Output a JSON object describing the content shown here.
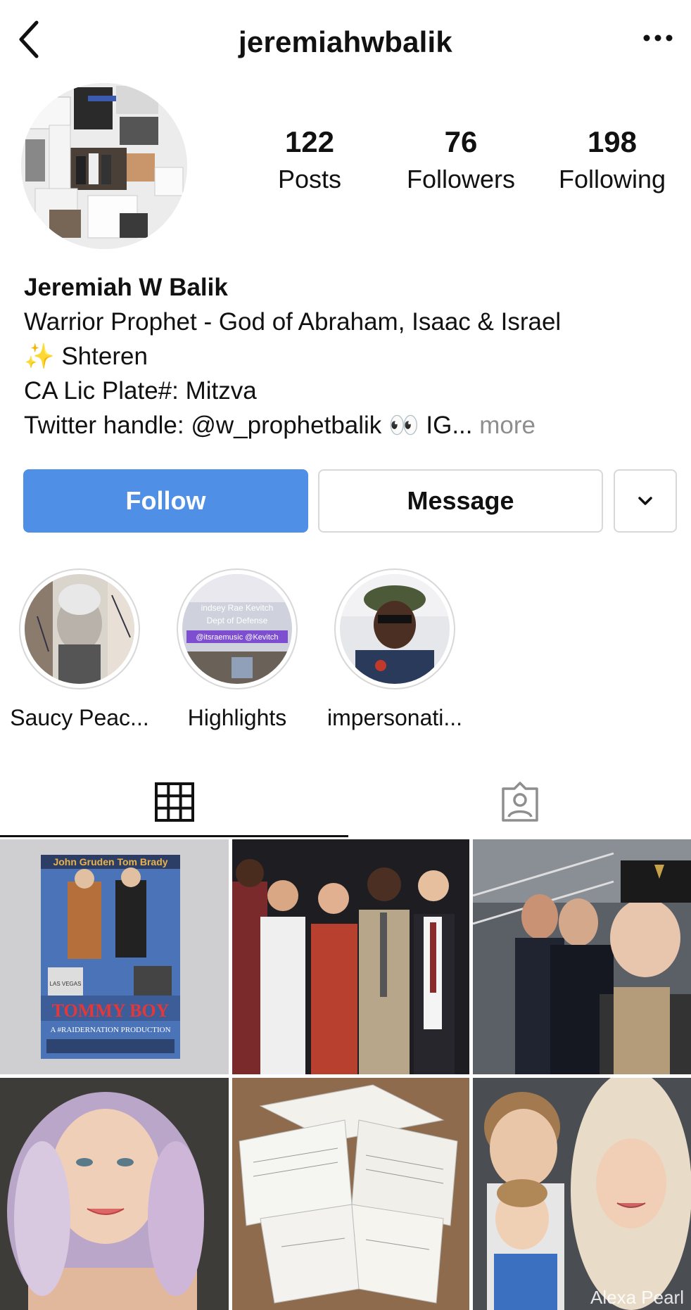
{
  "header": {
    "username": "jeremiahwbalik",
    "back_icon": "chevron-left-icon",
    "more_icon": "more-horizontal-icon"
  },
  "stats": {
    "posts": {
      "value": "122",
      "label": "Posts"
    },
    "followers": {
      "value": "76",
      "label": "Followers"
    },
    "following": {
      "value": "198",
      "label": "Following"
    }
  },
  "bio": {
    "name": "Jeremiah W Balik",
    "line1": "Warrior Prophet - God of Abraham, Isaac & Israel",
    "line2_emoji": "✨",
    "line2": "Shteren",
    "line3": "CA Lic Plate#: Mitzva",
    "line4": "Twitter handle: @w_prophetbalik",
    "line4_emoji": "👀",
    "line4_tail": " IG...",
    "more": " more"
  },
  "actions": {
    "follow": "Follow",
    "message": "Message",
    "dropdown_icon": "chevron-down-icon"
  },
  "highlights": [
    {
      "label": "Saucy Peac..."
    },
    {
      "label": "Highlights",
      "overlay_text": [
        "indsey Rae Kevitch",
        "Dept of Defense",
        "@itsraemusic @Kevitch"
      ]
    },
    {
      "label": "impersonati..."
    }
  ],
  "tabs": {
    "grid_icon": "grid-icon",
    "tagged_icon": "tagged-person-icon",
    "active": "grid"
  },
  "posts": [
    {
      "id": "poster",
      "lines": [
        "John Gruden   Tom Brady",
        "TOMMY BOY",
        "A #RAIDERNATION PRODUCTION",
        "LAS VEGAS"
      ]
    },
    {
      "id": "group-photo"
    },
    {
      "id": "arena-selfie"
    },
    {
      "id": "portrait"
    },
    {
      "id": "documents"
    },
    {
      "id": "car-selfie",
      "watermark": "Alexa Pearl"
    }
  ],
  "colors": {
    "follow_button": "#4f8fe6",
    "border": "#d8d8d8",
    "muted_text": "#8e8e8e"
  }
}
